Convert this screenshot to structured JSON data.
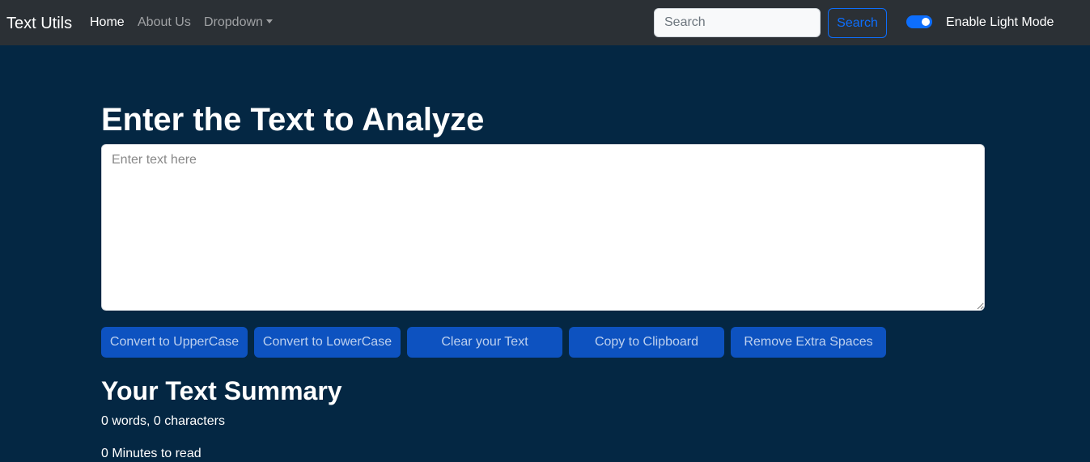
{
  "navbar": {
    "brand": "Text Utils",
    "links": [
      {
        "label": "Home"
      },
      {
        "label": "About Us"
      },
      {
        "label": "Dropdown"
      }
    ],
    "search_placeholder": "Search",
    "search_button": "Search",
    "toggle_label": "Enable Light Mode"
  },
  "main": {
    "heading": "Enter the Text to Analyze",
    "textarea_placeholder": "Enter text here",
    "buttons": [
      {
        "label": "Convert to UpperCase"
      },
      {
        "label": "Convert to LowerCase"
      },
      {
        "label": "Clear your Text"
      },
      {
        "label": "Copy to Clipboard"
      },
      {
        "label": "Remove Extra Spaces"
      }
    ]
  },
  "summary": {
    "heading": "Your Text Summary",
    "counts": "0 words, 0 characters",
    "read_time": "0 Minutes to read"
  },
  "colors": {
    "navbar_bg": "#2b3035",
    "page_bg": "#042743",
    "primary": "#0d6efd",
    "button_bg": "#0d52c0"
  }
}
